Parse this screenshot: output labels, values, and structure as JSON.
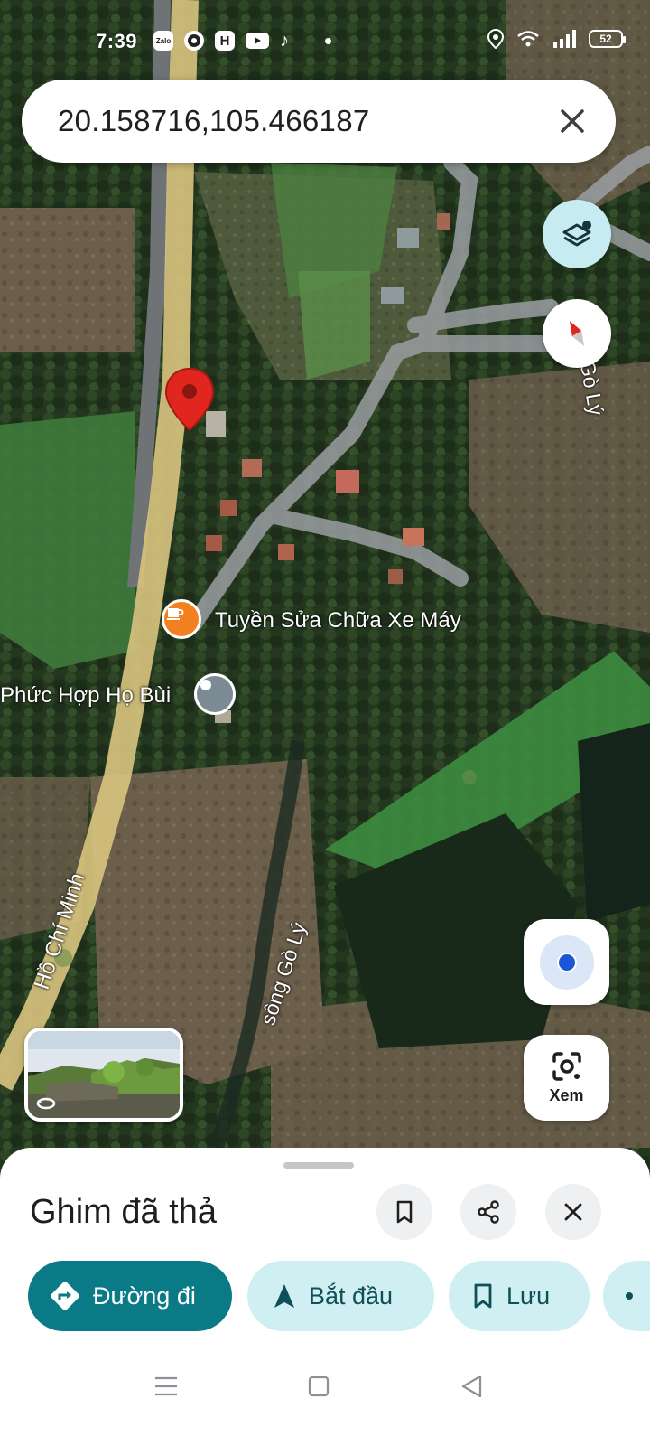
{
  "status_bar": {
    "time": "7:39",
    "app_icons": [
      "Zalo",
      "chrome-like",
      "H",
      "youtube",
      "tiktok"
    ],
    "battery": "52"
  },
  "search": {
    "value": "20.158716,105.466187"
  },
  "map": {
    "labels": {
      "poi_repair": "Tuyền Sửa Chữa Xe Máy",
      "poi_complex": "Phức Hợp Họ Bùi",
      "road": "Hồ Chí Minh",
      "river_lower": "sông Gò Lý",
      "river_upper": "sông Gò Lý"
    }
  },
  "controls": {
    "xem_label": "Xem"
  },
  "sheet": {
    "title": "Ghim đã thả",
    "chips": {
      "directions": "Đường đi",
      "start": "Bắt đầu",
      "save": "Lưu"
    }
  },
  "colors": {
    "primary_chip": "#0b7a87",
    "secondary_chip": "#cfeff3",
    "layers_fab": "#c6ecf2",
    "pin": "#e0261e",
    "poi_orange": "#f3801f",
    "poi_gray": "#7b8a93",
    "road_yellow": "#d9c47e"
  },
  "icons": [
    "layers-icon",
    "compass-icon",
    "my-location-icon",
    "lens-icon",
    "bookmark-icon",
    "share-icon",
    "close-icon",
    "directions-icon",
    "navigation-arrow-icon",
    "menu-icon",
    "home-icon",
    "back-icon",
    "dropped-pin-icon",
    "cafe-icon",
    "place-icon",
    "rotate-360-icon"
  ]
}
